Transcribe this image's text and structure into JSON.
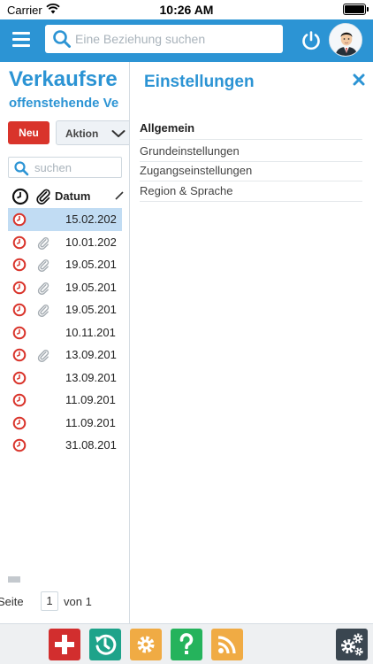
{
  "status_bar": {
    "carrier": "Carrier",
    "time": "10:26 AM"
  },
  "header": {
    "search_placeholder": "Eine Beziehung suchen"
  },
  "left_panel": {
    "title": "Verkaufsre",
    "subtitle": "offenstehende Ve",
    "new_button": "Neu",
    "action_button": "Aktion",
    "search_placeholder": "suchen",
    "column_date": "Datum",
    "rows": [
      {
        "date": "15.02.202",
        "attachment": false,
        "selected": true
      },
      {
        "date": "10.01.202",
        "attachment": true,
        "selected": false
      },
      {
        "date": "19.05.201",
        "attachment": true,
        "selected": false
      },
      {
        "date": "19.05.201",
        "attachment": true,
        "selected": false
      },
      {
        "date": "19.05.201",
        "attachment": true,
        "selected": false
      },
      {
        "date": "10.11.201",
        "attachment": false,
        "selected": false
      },
      {
        "date": "13.09.201",
        "attachment": true,
        "selected": false
      },
      {
        "date": "13.09.201",
        "attachment": false,
        "selected": false
      },
      {
        "date": "11.09.201",
        "attachment": false,
        "selected": false
      },
      {
        "date": "11.09.201",
        "attachment": false,
        "selected": false
      },
      {
        "date": "31.08.201",
        "attachment": false,
        "selected": false
      }
    ],
    "pager": {
      "page_label": "Seite",
      "page_value": "1",
      "of_label": "von 1"
    }
  },
  "settings_panel": {
    "title": "Einstellungen",
    "section": "Allgemein",
    "items": [
      "Grundeinstellungen",
      "Zugangseinstellungen",
      "Region & Sprache"
    ]
  },
  "toolbar": {
    "buttons": [
      {
        "icon": "plus-icon",
        "color": "#d22e2e"
      },
      {
        "icon": "history-icon",
        "color": "#1ea38a"
      },
      {
        "icon": "gear-icon",
        "color": "#f0ab44"
      },
      {
        "icon": "question-icon",
        "color": "#25b35c"
      },
      {
        "icon": "rss-icon",
        "color": "#f0ab44"
      },
      {
        "icon": "gears-icon",
        "color": "#3a4650"
      }
    ]
  },
  "colors": {
    "accent": "#2c94d4",
    "danger": "#d9342b",
    "selected_row": "#c1dcf3"
  }
}
